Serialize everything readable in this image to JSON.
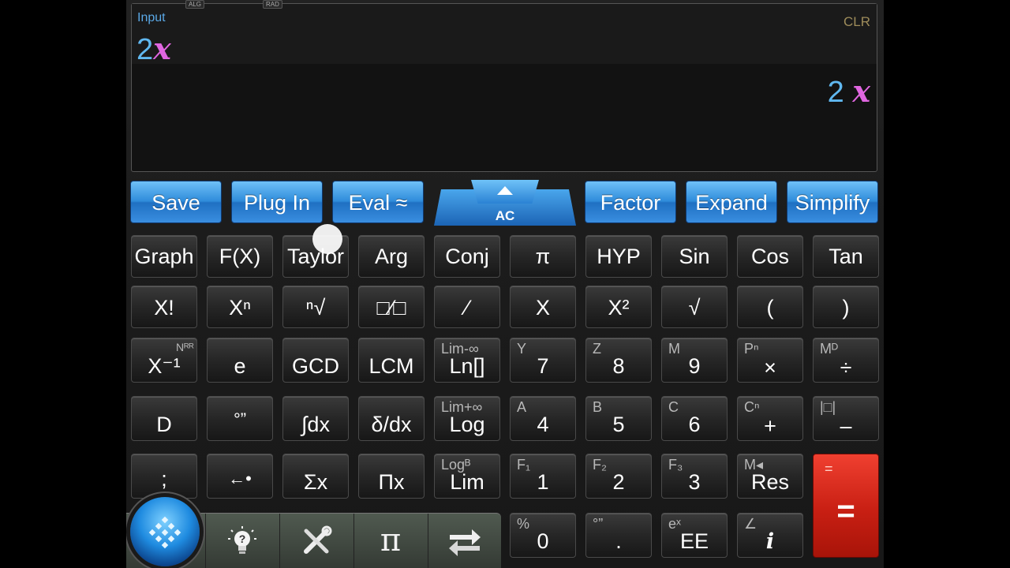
{
  "display": {
    "tag_mode": "ALG",
    "tag_angle": "RAD",
    "input_label": "Input",
    "clear_label": "CLR",
    "input_expr": {
      "num": "2",
      "var": "x"
    },
    "result_expr": {
      "num": "2",
      "var": "x"
    }
  },
  "top_row": {
    "save": "Save",
    "plug_in": "Plug In",
    "eval": "Eval ≈",
    "ac": "AC",
    "factor": "Factor",
    "expand": "Expand",
    "simplify": "Simplify"
  },
  "keys": {
    "r1": [
      "Graph",
      "F(X)",
      "Taylor",
      "Arg",
      "Conj",
      "π",
      "HYP",
      "Sin",
      "Cos",
      "Tan"
    ],
    "r2": [
      "X!",
      "Xⁿ",
      "ⁿ√",
      "□⁄□",
      "⁄",
      "X",
      "X²",
      "√",
      "(",
      ")"
    ],
    "r3": {
      "main": [
        "X⁻¹",
        "e",
        "GCD",
        "LCM",
        "Ln[]",
        "7",
        "8",
        "9",
        "×",
        "÷"
      ],
      "sub": [
        "Nᴿᴿ",
        "",
        "",
        "",
        "Lim-∞",
        "Y",
        "Z",
        "M",
        "Pⁿ",
        "Mᴰ"
      ]
    },
    "r4": {
      "main": [
        "D",
        "°”",
        "∫dx",
        "δ/dx",
        "Log",
        "4",
        "5",
        "6",
        "+",
        "–"
      ],
      "sub": [
        "",
        "",
        "",
        "",
        "Lim+∞",
        "A",
        "B",
        "C",
        "Cⁿ",
        "|□|"
      ]
    },
    "r5": {
      "main": [
        ";",
        "←•",
        "Σx",
        "Πx",
        "Lim",
        "1",
        "2",
        "3",
        "Res"
      ],
      "sub": [
        "",
        "",
        "",
        "",
        "Logᴮ",
        "F₁",
        "F₂",
        "F₃",
        "M◂"
      ]
    },
    "r6": {
      "main": [
        "0",
        ".",
        "EE",
        "i"
      ],
      "sub": [
        "%",
        "°”",
        "eˣ",
        "∠"
      ]
    },
    "equals": {
      "main": "=",
      "sub": "="
    }
  },
  "dock": {
    "icons": [
      "grid-icon",
      "lightbulb-question-icon",
      "tools-icon",
      "pi-icon",
      "swap-arrows-icon"
    ]
  },
  "colors": {
    "accent_blue": "#2f8cdb",
    "equals_red": "#c81f13",
    "number_blue": "#60b8f0",
    "variable_magenta": "#e066e0",
    "clr_gold": "#9e8c5a"
  }
}
